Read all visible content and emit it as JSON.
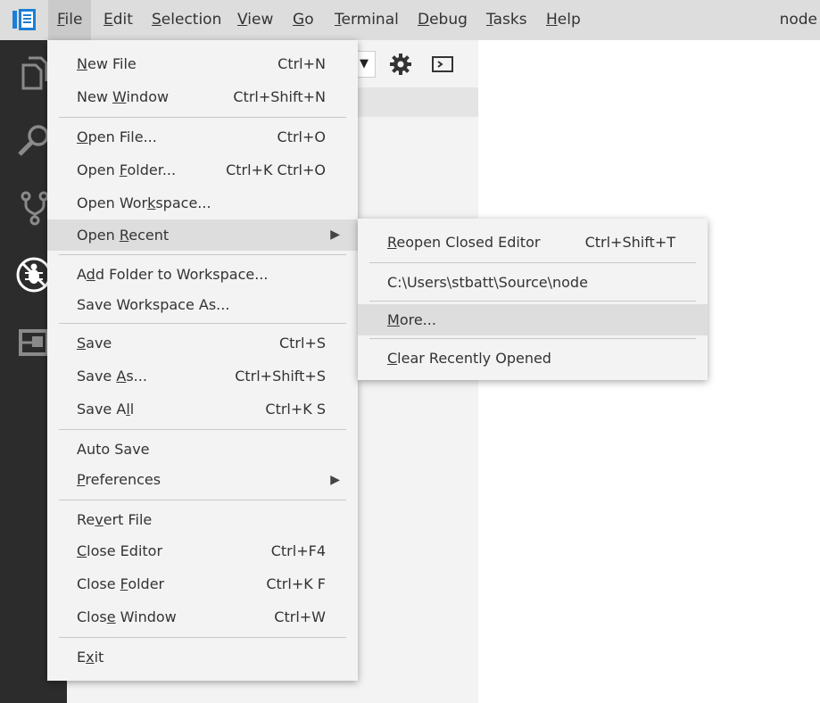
{
  "window_title": "node",
  "menubar": [
    {
      "label": "File",
      "ul": "F",
      "rest": "ile"
    },
    {
      "label": "Edit",
      "ul": "E",
      "rest": "dit"
    },
    {
      "label": "Selection",
      "ul": "S",
      "rest": "election"
    },
    {
      "label": "View",
      "ul": "V",
      "rest": "iew"
    },
    {
      "label": "Go",
      "ul": "G",
      "rest": "o"
    },
    {
      "label": "Terminal",
      "ul": "T",
      "rest": "erminal"
    },
    {
      "label": "Debug",
      "ul": "D",
      "rest": "ebug"
    },
    {
      "label": "Tasks",
      "ul": "T",
      "rest": "asks"
    },
    {
      "label": "Help",
      "ul": "H",
      "rest": "elp"
    }
  ],
  "colors": {
    "titlebar": "#dddddd",
    "activitybar": "#2c2c2c",
    "menu_bg": "#f3f3f3",
    "menu_highlight": "#dddddd",
    "accent": "#007acc"
  },
  "icons": {
    "logo": "vscode-logo-icon",
    "activity": [
      "explorer-icon",
      "search-icon",
      "source-control-icon",
      "debug-icon",
      "extensions-icon"
    ],
    "toolbar": [
      "gear-icon",
      "terminal-icon"
    ]
  },
  "sidebar": {
    "dropdown_caret": "▼"
  },
  "file_menu": {
    "new_file": {
      "pre": "",
      "ul": "N",
      "post": "ew File",
      "shortcut": "Ctrl+N"
    },
    "new_window": {
      "pre": "New ",
      "ul": "W",
      "post": "indow",
      "shortcut": "Ctrl+Shift+N"
    },
    "open_file": {
      "pre": "",
      "ul": "O",
      "post": "pen File...",
      "shortcut": "Ctrl+O"
    },
    "open_folder": {
      "pre": "Open ",
      "ul": "F",
      "post": "older...",
      "shortcut": "Ctrl+K Ctrl+O"
    },
    "open_workspace": {
      "pre": "Open Wor",
      "ul": "k",
      "post": "space..."
    },
    "open_recent": {
      "pre": "Open ",
      "ul": "R",
      "post": "ecent",
      "arrow": "▶"
    },
    "add_folder": {
      "pre": "A",
      "ul": "d",
      "post": "d Folder to Workspace..."
    },
    "save_workspace_as": {
      "pre": "Save Workspace As...",
      "ul": "",
      "post": ""
    },
    "save": {
      "pre": "",
      "ul": "S",
      "post": "ave",
      "shortcut": "Ctrl+S"
    },
    "save_as": {
      "pre": "Save ",
      "ul": "A",
      "post": "s...",
      "shortcut": "Ctrl+Shift+S"
    },
    "save_all": {
      "pre": "Save A",
      "ul": "l",
      "post": "l",
      "shortcut": "Ctrl+K S"
    },
    "auto_save": {
      "pre": "Auto Save",
      "ul": "",
      "post": ""
    },
    "preferences": {
      "pre": "",
      "ul": "P",
      "post": "references",
      "arrow": "▶"
    },
    "revert_file": {
      "pre": "Re",
      "ul": "v",
      "post": "ert File"
    },
    "close_editor": {
      "pre": "",
      "ul": "C",
      "post": "lose Editor",
      "shortcut": "Ctrl+F4"
    },
    "close_folder": {
      "pre": "Close ",
      "ul": "F",
      "post": "older",
      "shortcut": "Ctrl+K F"
    },
    "close_window": {
      "pre": "Clos",
      "ul": "e",
      "post": " Window",
      "shortcut": "Ctrl+W"
    },
    "exit": {
      "pre": "E",
      "ul": "x",
      "post": "it"
    }
  },
  "recent_menu": {
    "reopen": {
      "pre": "",
      "ul": "R",
      "post": "eopen Closed Editor",
      "shortcut": "Ctrl+Shift+T"
    },
    "path": {
      "pre": "C:\\Users\\stbatt\\Source\\node",
      "ul": "",
      "post": ""
    },
    "more": {
      "pre": "",
      "ul": "M",
      "post": "ore..."
    },
    "clear": {
      "pre": "",
      "ul": "C",
      "post": "lear Recently Opened"
    }
  }
}
